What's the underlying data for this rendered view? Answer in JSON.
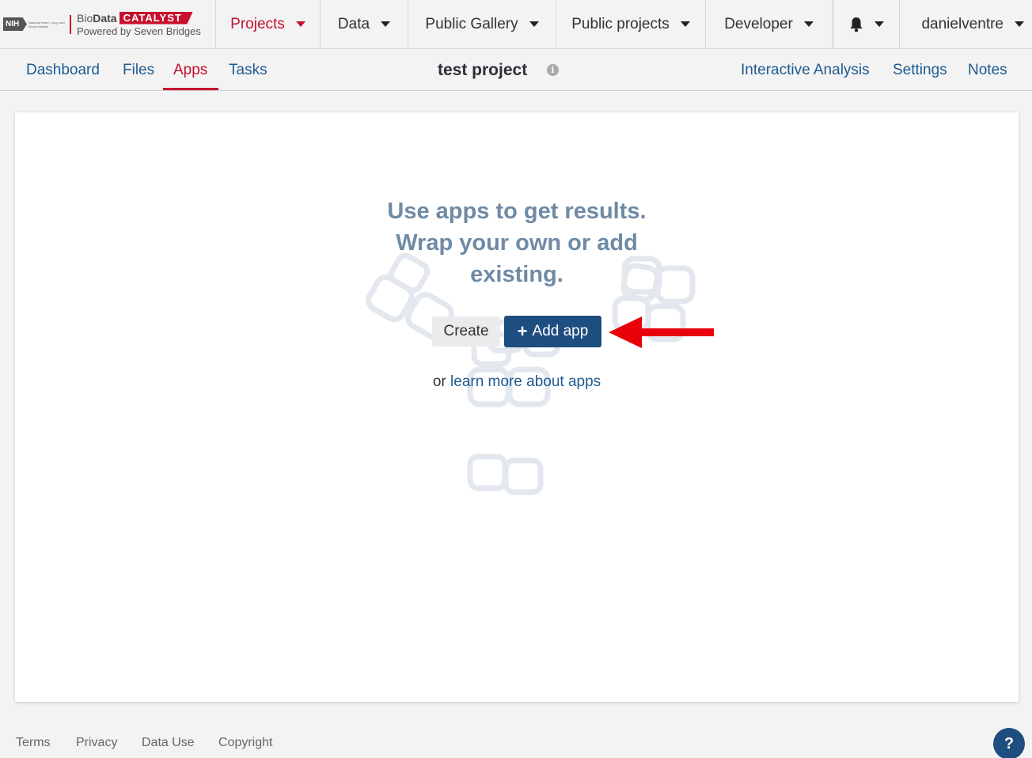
{
  "brand": {
    "nih": "NIH",
    "nih_subtext": "National Heart, Lung, and Blood Institute",
    "bio": "Bio",
    "data": "Data",
    "catalyst": "CATALYST",
    "powered": "Powered by Seven Bridges"
  },
  "nav": {
    "projects": "Projects",
    "data": "Data",
    "public_gallery": "Public Gallery",
    "public_projects": "Public projects",
    "developer": "Developer",
    "user": "danielventre"
  },
  "subnav": {
    "dashboard": "Dashboard",
    "files": "Files",
    "apps": "Apps",
    "tasks": "Tasks",
    "project_title": "test project",
    "interactive_analysis": "Interactive Analysis",
    "settings": "Settings",
    "notes": "Notes"
  },
  "empty_state": {
    "line1": "Use apps to get results.",
    "line2": "Wrap your own or add",
    "line3": "existing.",
    "create_label": "Create",
    "add_app_label": "Add app",
    "learn_prefix": "or",
    "learn_link": "learn more about apps"
  },
  "footer": {
    "terms": "Terms",
    "privacy": "Privacy",
    "data_use": "Data Use",
    "copyright": "Copyright",
    "help": "?"
  },
  "colors": {
    "accent_red": "#c8102e",
    "link_blue": "#1e5a8e",
    "primary_button": "#1e4d80",
    "annotation_arrow": "#e8000b"
  }
}
